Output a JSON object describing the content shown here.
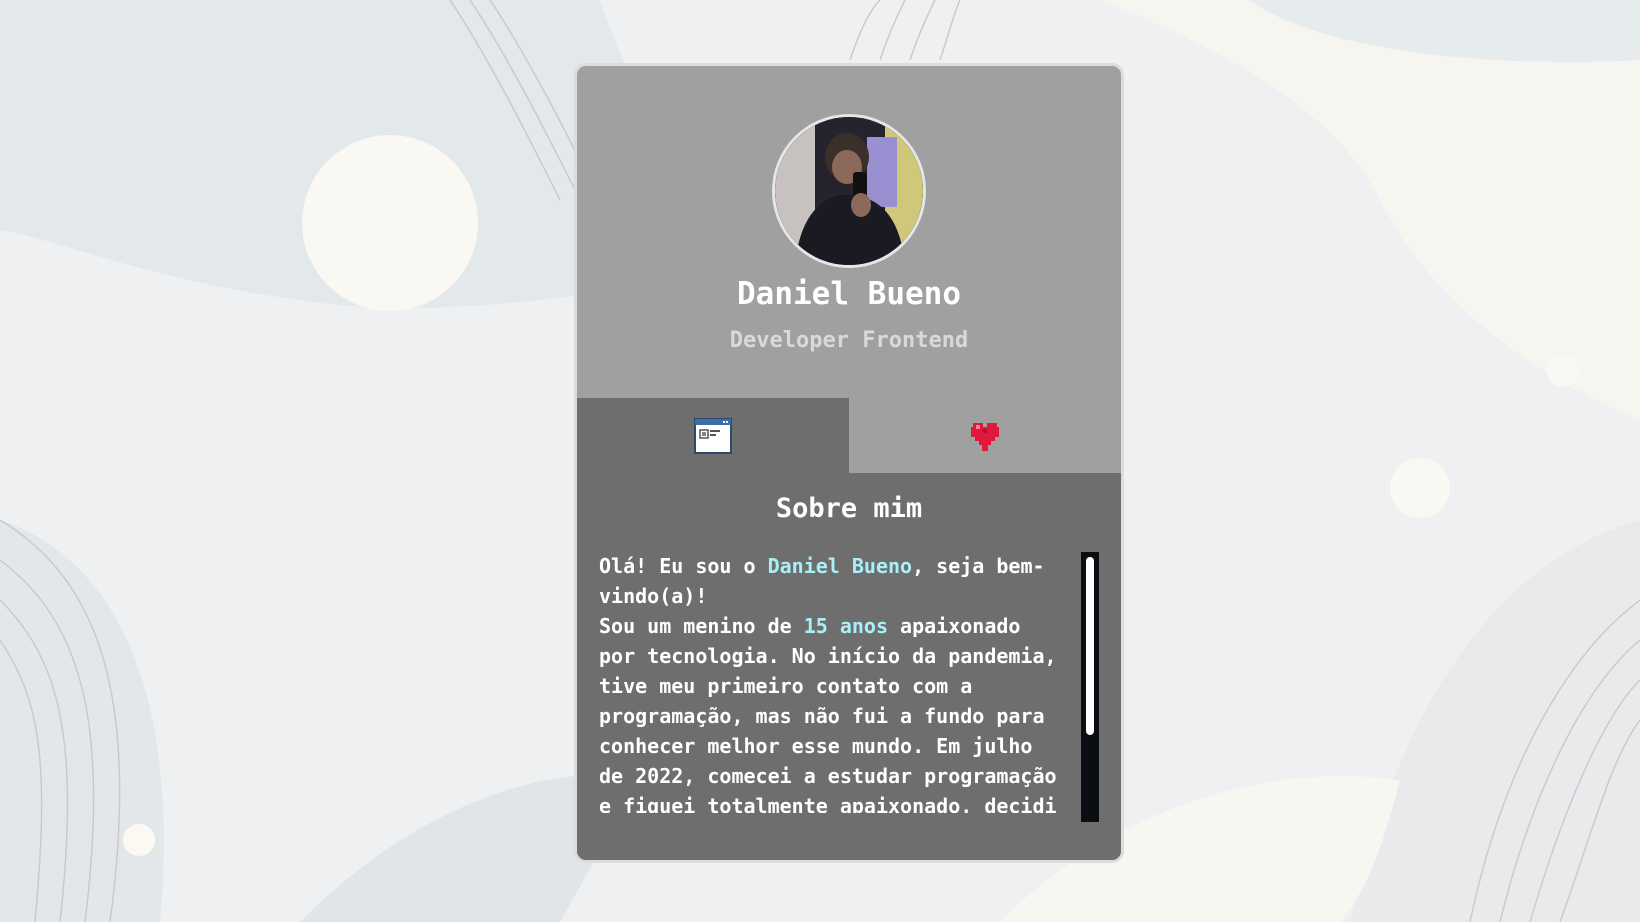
{
  "profile": {
    "name": "Daniel Bueno",
    "role": "Developer Frontend"
  },
  "tabs": [
    {
      "icon": "browser-window-icon",
      "active": true
    },
    {
      "icon": "pixel-heart-icon",
      "active": false
    }
  ],
  "about": {
    "title": "Sobre mim",
    "p1_pre": "Olá! Eu sou o ",
    "p1_name": "Daniel Bueno",
    "p1_post": ", seja bem-vindo(a)!",
    "p2_pre": "Sou um menino de ",
    "p2_age": "15 anos",
    "p2_post": " apaixonado por tecnologia. No início da pandemia, tive meu primeiro contato com a programação, mas não fui a fundo para conhecer melhor esse mundo. Em julho de 2022, comecei a estudar programação e fiquei totalmente apaixonado, decidi"
  },
  "colors": {
    "card": "#a0a0a0",
    "content": "#6e6e6e",
    "highlight": "#a8f0f8",
    "heart": "#e0183c"
  }
}
